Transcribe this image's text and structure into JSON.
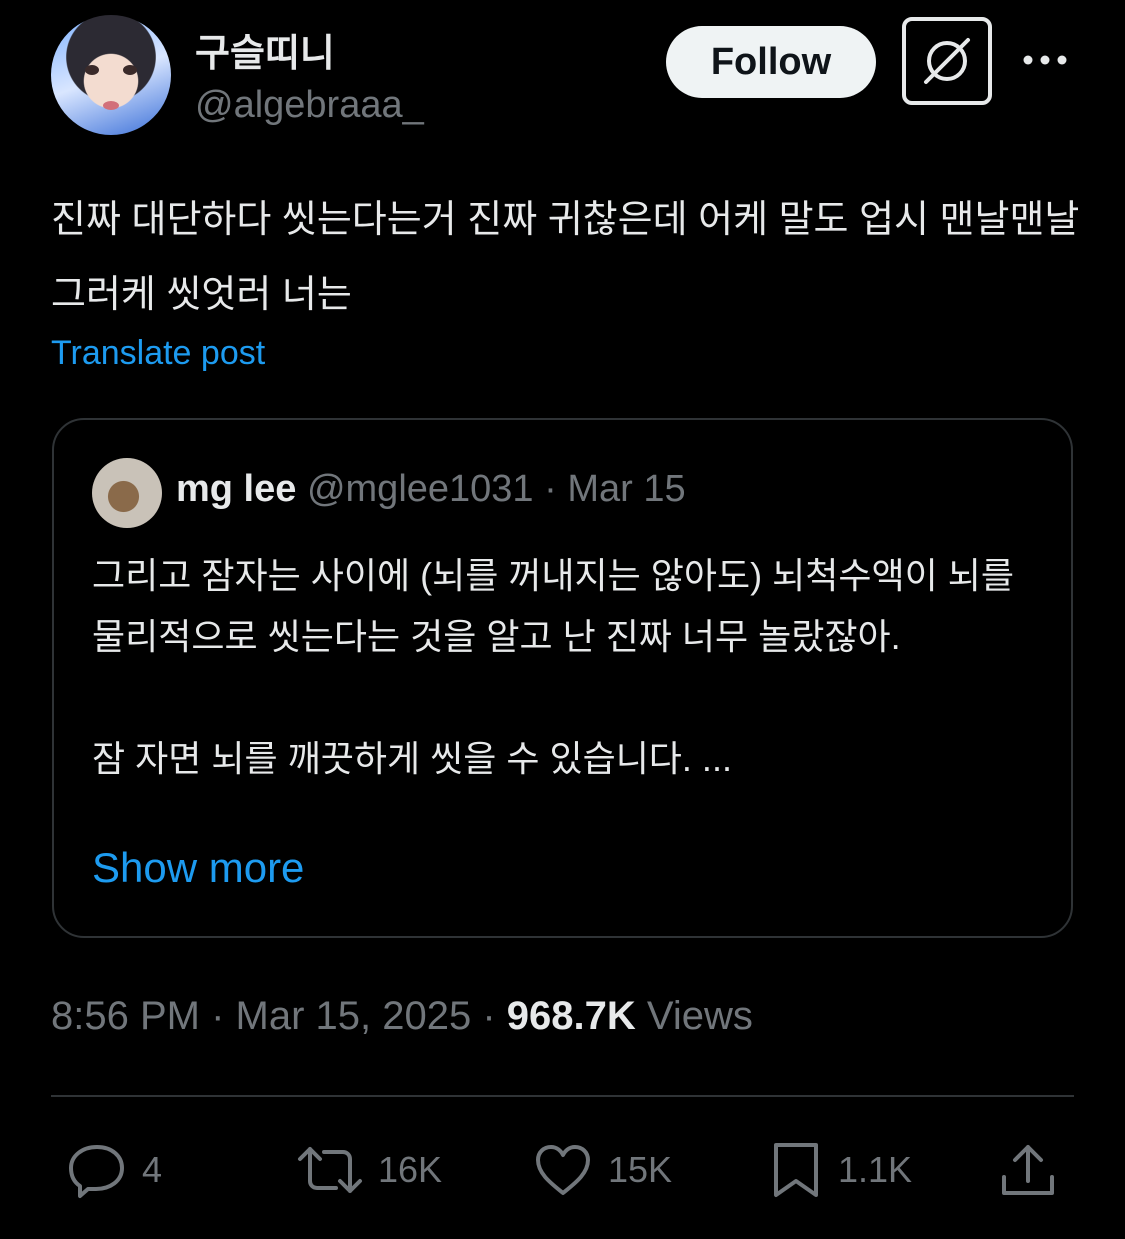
{
  "author": {
    "display_name": "구슬띠니",
    "handle": "@algebraaa_"
  },
  "header": {
    "follow_label": "Follow",
    "grok_icon": "grok-icon",
    "more_icon": "more-icon"
  },
  "tweet": {
    "text": "진짜 대단하다 씻는다는거 진짜 귀찮은데 어케 말도 업시 맨날맨날 그러케 씻엇러 너는",
    "translate_label": "Translate post"
  },
  "quote": {
    "name": "mg lee",
    "handle": "@mglee1031",
    "separator": "·",
    "date": "Mar 15",
    "paragraph1": "그리고 잠자는 사이에 (뇌를 꺼내지는 않아도) 뇌척수액이 뇌를 물리적으로 씻는다는 것을 알고 난 진짜 너무 놀랐잖아.",
    "paragraph2": "잠 자면 뇌를 깨끗하게 씻을 수 있습니다. ...",
    "show_more": "Show more"
  },
  "meta": {
    "time": "8:56 PM",
    "sep1": " · ",
    "date": "Mar 15, 2025",
    "sep2": " · ",
    "views_count": "968.7K",
    "views_label": "Views"
  },
  "actions": {
    "replies": "4",
    "reposts": "16K",
    "likes": "15K",
    "bookmarks": "1.1K"
  },
  "colors": {
    "background": "#000000",
    "text": "#e7e9ea",
    "secondary": "#71767b",
    "link": "#1d9bf0",
    "border": "#2f3336"
  }
}
